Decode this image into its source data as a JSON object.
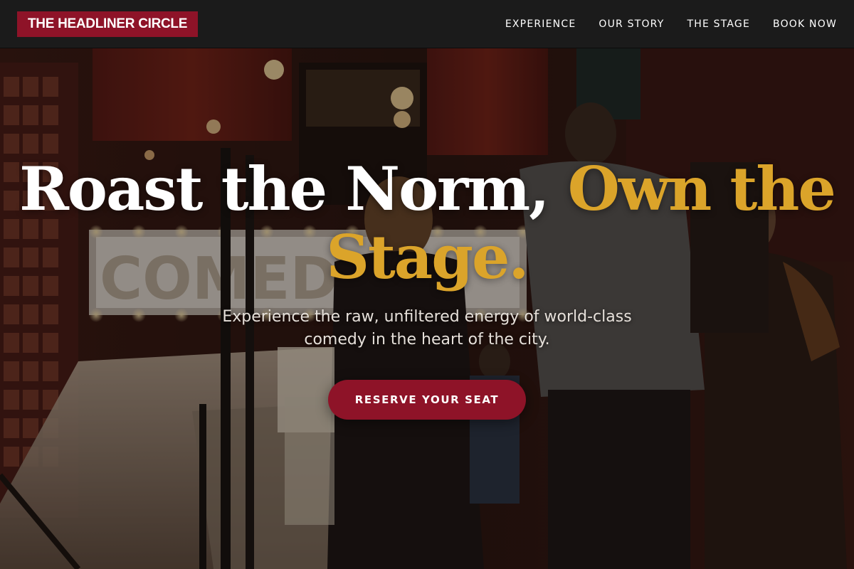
{
  "brand": {
    "name": "THE HEADLINER CIRCLE",
    "accent_color": "#8e1328",
    "gold_color": "#dba42a"
  },
  "nav": {
    "items": [
      {
        "label": "EXPERIENCE"
      },
      {
        "label": "OUR STORY"
      },
      {
        "label": "THE STAGE"
      },
      {
        "label": "BOOK NOW"
      }
    ]
  },
  "hero": {
    "headline_white": "Roast the Norm,",
    "headline_gold": "Own the Stage.",
    "subtitle": "Experience the raw, unfiltered energy of world-class comedy in the heart of the city.",
    "cta_label": "RESERVE YOUR SEAT",
    "background_sign": "COMEDY"
  }
}
